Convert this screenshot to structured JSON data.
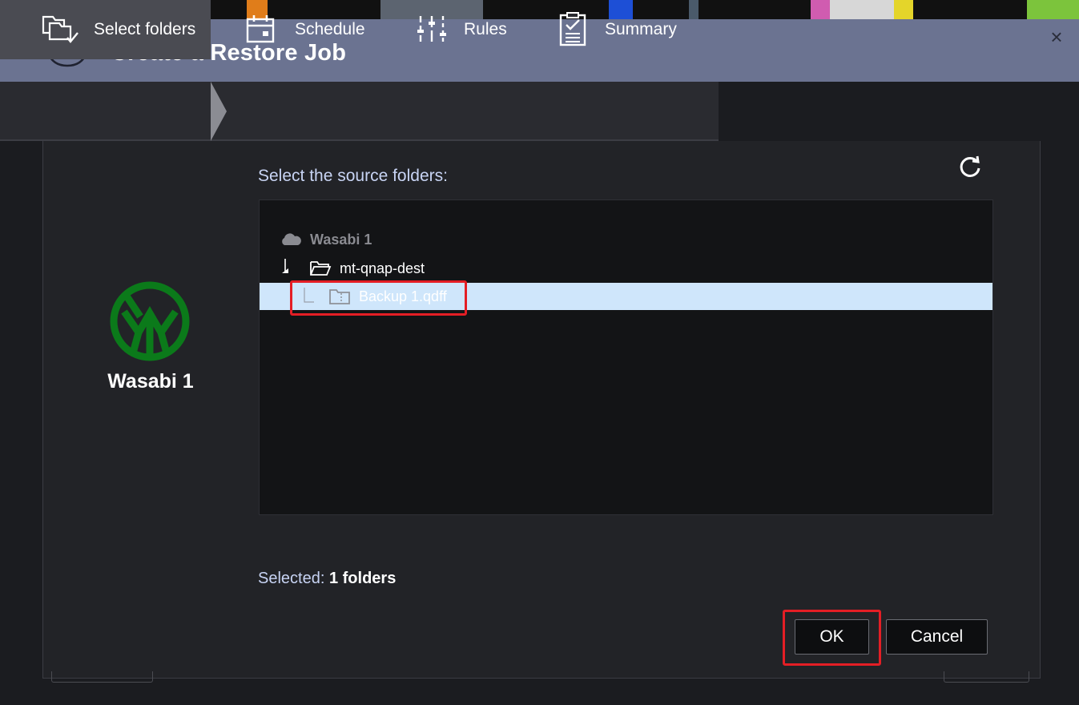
{
  "window": {
    "title": "Create a Restore Job",
    "close_symbol": "×"
  },
  "steps": [
    {
      "label": "Select folders",
      "icon": "folders-check-icon",
      "active": true
    },
    {
      "label": "Schedule",
      "icon": "calendar-icon",
      "active": false
    },
    {
      "label": "Rules",
      "icon": "sliders-icon",
      "active": false
    },
    {
      "label": "Summary",
      "icon": "clipboard-check-icon",
      "active": false
    }
  ],
  "source": {
    "name": "Wasabi 1",
    "logo": "wasabi-logo",
    "logo_color": "#0b7a1a"
  },
  "main": {
    "section_label": "Select the source folders:",
    "tree": {
      "root": {
        "label": "Wasabi 1",
        "icon": "cloud-icon"
      },
      "folder": {
        "label": "mt-qnap-dest",
        "icon": "folder-open-icon"
      },
      "file": {
        "label": "Backup 1.qdff",
        "icon": "archive-folder-icon",
        "selected": true
      }
    },
    "selected_prefix": "Selected:",
    "selected_value": "1 folders"
  },
  "buttons": {
    "ok": "OK",
    "cancel": "Cancel"
  },
  "colors": {
    "titlebar": "#6b7391",
    "selected_row": "#cfe6fb",
    "highlight": "#e41e25",
    "label_text": "#c8d4f4"
  }
}
